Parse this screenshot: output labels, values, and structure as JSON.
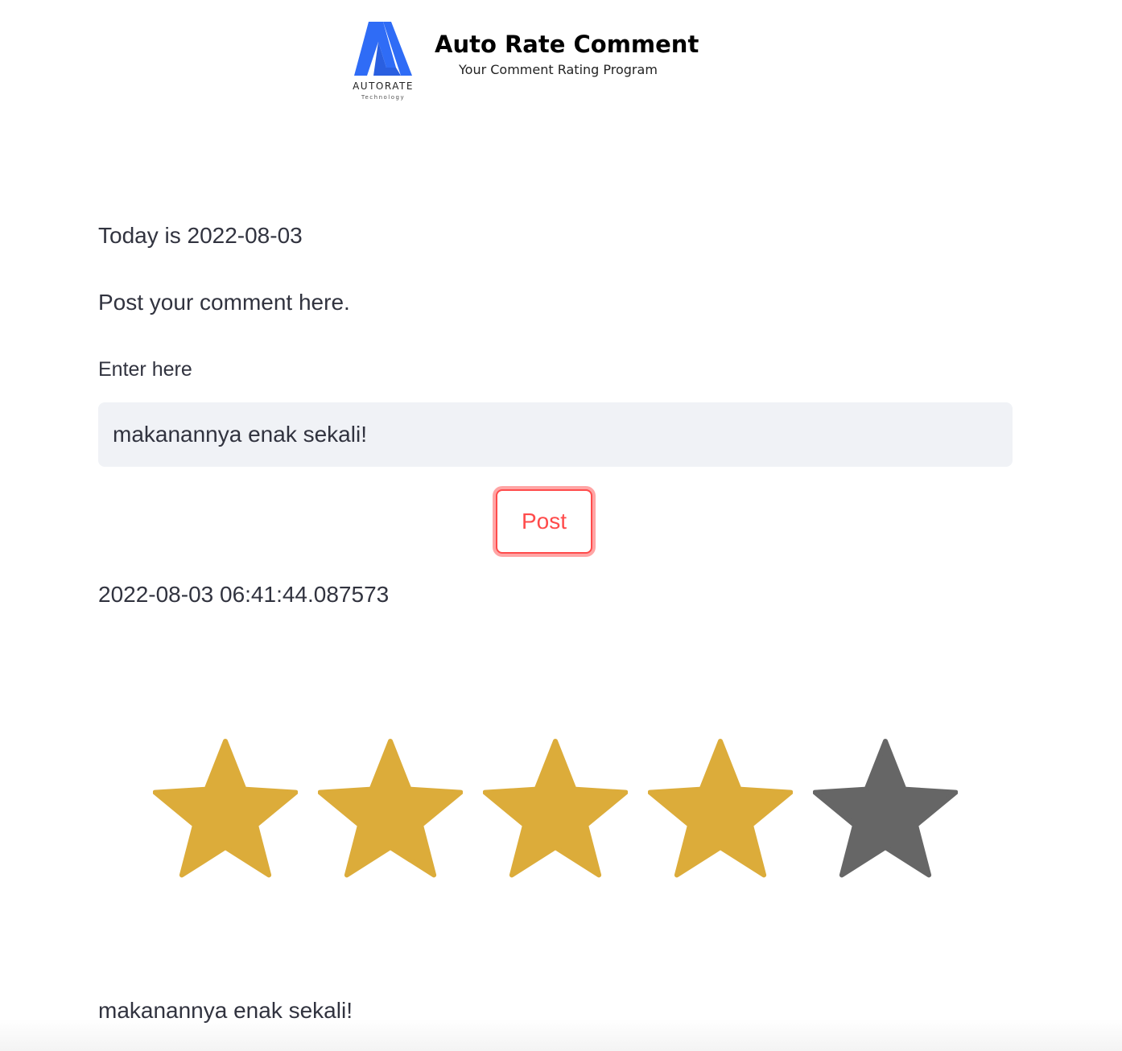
{
  "header": {
    "logo_text": "AUTORATE",
    "logo_subtext": "Technology",
    "title": "Auto Rate Comment",
    "tagline": "Your Comment Rating Program"
  },
  "main": {
    "today_text": "Today is 2022-08-03",
    "prompt_text": "Post your comment here.",
    "input_label": "Enter here",
    "input_value": "makanannya enak sekali!",
    "post_button_label": "Post",
    "timestamp": "2022-08-03 06:41:44.087573",
    "rating": {
      "filled": 4,
      "max": 5,
      "filled_color": "#dcac3a",
      "empty_color": "#666666"
    },
    "posted_comment": "makanannya enak sekali!"
  },
  "colors": {
    "accent": "#ff4b4b",
    "logo_blue": "#2f6cf6",
    "text": "#31333f",
    "input_bg": "#f0f2f6"
  }
}
